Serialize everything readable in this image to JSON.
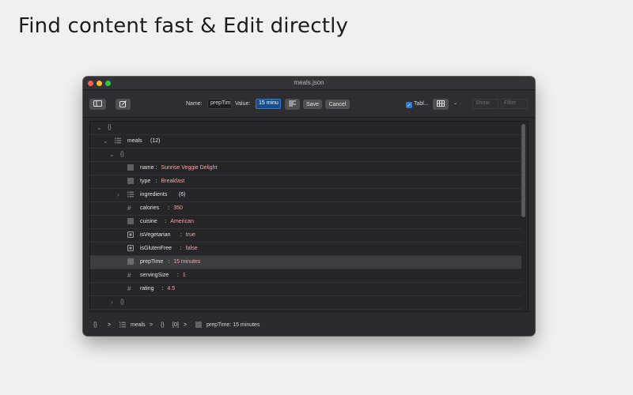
{
  "headline": "Find content fast & Edit directly",
  "window": {
    "title": "meals.json"
  },
  "toolbar": {
    "name_label": "Name:",
    "name_value": "prepTim",
    "value_label": "Value:",
    "value_value": "15 minu",
    "save_label": "Save",
    "cancel_label": "Cancel",
    "table_label": "Tabl...",
    "table_checked": true,
    "show_placeholder": "Show",
    "filter_placeholder": "Filter"
  },
  "tree": {
    "root_label": "{}",
    "meals_key": "meals",
    "meals_count": "(12)",
    "item_label": "{}",
    "rows": [
      {
        "key": "name",
        "sep": ":",
        "value": "Sunrise Veggie Delight",
        "icon": "text-icon"
      },
      {
        "key": "type",
        "sep": ":",
        "value": "Breakfast",
        "icon": "text-icon"
      },
      {
        "key": "ingredients",
        "count": "(6)",
        "icon": "list-icon"
      },
      {
        "key": "calories",
        "sep": ":",
        "value": "350",
        "icon": "number-icon"
      },
      {
        "key": "cuisine",
        "sep": ":",
        "value": "American",
        "icon": "text-icon"
      },
      {
        "key": "isVegetarian",
        "sep": ":",
        "value": "true",
        "icon": "boolean-icon"
      },
      {
        "key": "isGlutenFree",
        "sep": ":",
        "value": "false",
        "icon": "boolean-icon"
      },
      {
        "key": "prepTime",
        "sep": ":",
        "value": "15 minutes",
        "icon": "text-icon"
      },
      {
        "key": "servingSize",
        "sep": ":",
        "value": "1",
        "icon": "number-icon"
      },
      {
        "key": "rating",
        "sep": ":",
        "value": "4.5",
        "icon": "number-icon"
      }
    ],
    "next_item_label": "{}"
  },
  "statusbar": {
    "root": "{}",
    "sep1": ">",
    "meals": "meals",
    "sep2": ">",
    "index_braces": "{}",
    "index": "[0]",
    "sep3": ">",
    "current": "prepTime: 15 minutes"
  }
}
